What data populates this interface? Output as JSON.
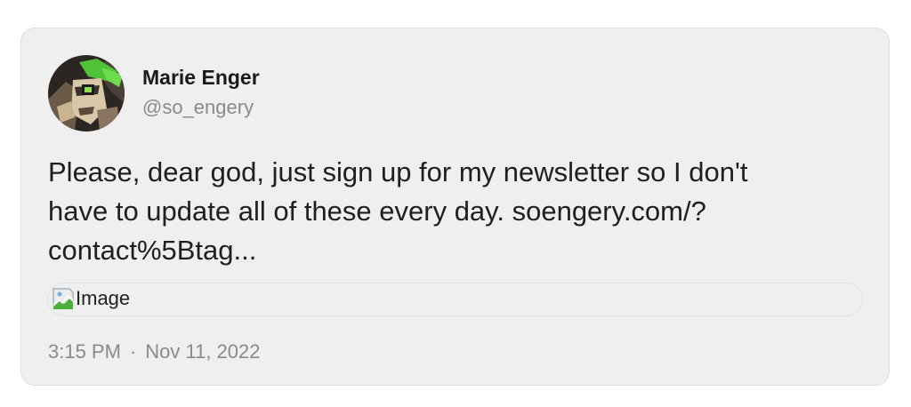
{
  "post": {
    "author_name": "Marie Enger",
    "author_handle": "@so_engery",
    "text": "Please, dear god, just sign up for my newsletter so I don't\nhave to update all of these every day. soengery.com/?\ncontact%5Btag...",
    "image_alt": "Image",
    "time": "3:15 PM",
    "separator": "·",
    "date": "Nov 11, 2022"
  },
  "icons": {
    "avatar": "avatar-illustration",
    "broken_image": "broken-image-icon"
  },
  "colors": {
    "card_background": "#efefef",
    "text_primary": "#1f1f1f",
    "text_secondary": "#8a8a8a"
  }
}
